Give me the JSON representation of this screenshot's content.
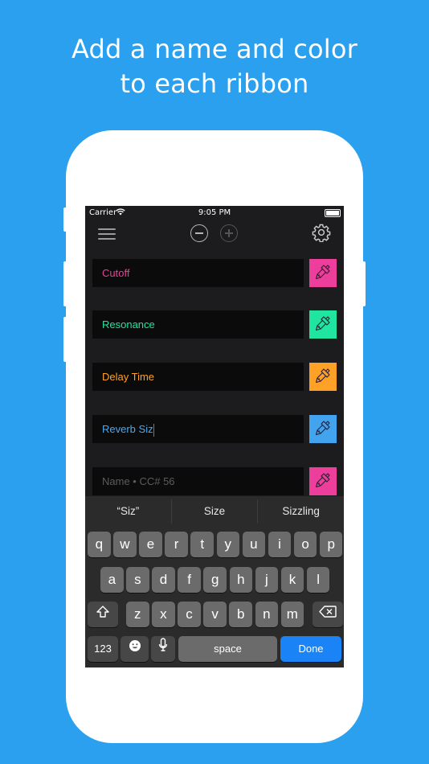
{
  "headline": {
    "line1": "Add a name and color",
    "line2": "to each ribbon"
  },
  "status_bar": {
    "carrier": "Carrier",
    "time": "9:05 PM"
  },
  "toolbar": {
    "menu_icon": "hamburger-menu-icon",
    "remove_icon": "minus-circle-icon",
    "add_icon": "plus-circle-icon",
    "settings_icon": "gear-icon"
  },
  "ribbons": [
    {
      "name": "Cutoff",
      "text_color": "#ee3e9c",
      "swatch_color": "#ee3e9c"
    },
    {
      "name": "Resonance",
      "text_color": "#1fe5a1",
      "swatch_color": "#1fe5a1"
    },
    {
      "name": "Delay Time",
      "text_color": "#ffa126",
      "swatch_color": "#ffa126"
    },
    {
      "name": "Reverb Siz",
      "text_color": "#4aa8f0",
      "swatch_color": "#42a4ef"
    },
    {
      "name": "",
      "placeholder": "Name • CC# 56",
      "text_color": "#5c5c5c",
      "swatch_color": "#ee3e9c"
    }
  ],
  "keyboard": {
    "suggestions": [
      "“Siz”",
      "Size",
      "Sizzling"
    ],
    "row1": [
      "q",
      "w",
      "e",
      "r",
      "t",
      "y",
      "u",
      "i",
      "o",
      "p"
    ],
    "row2": [
      "a",
      "s",
      "d",
      "f",
      "g",
      "h",
      "j",
      "k",
      "l"
    ],
    "row3": [
      "z",
      "x",
      "c",
      "v",
      "b",
      "n",
      "m"
    ],
    "numbers_key": "123",
    "space_key": "space",
    "done_key": "Done"
  }
}
